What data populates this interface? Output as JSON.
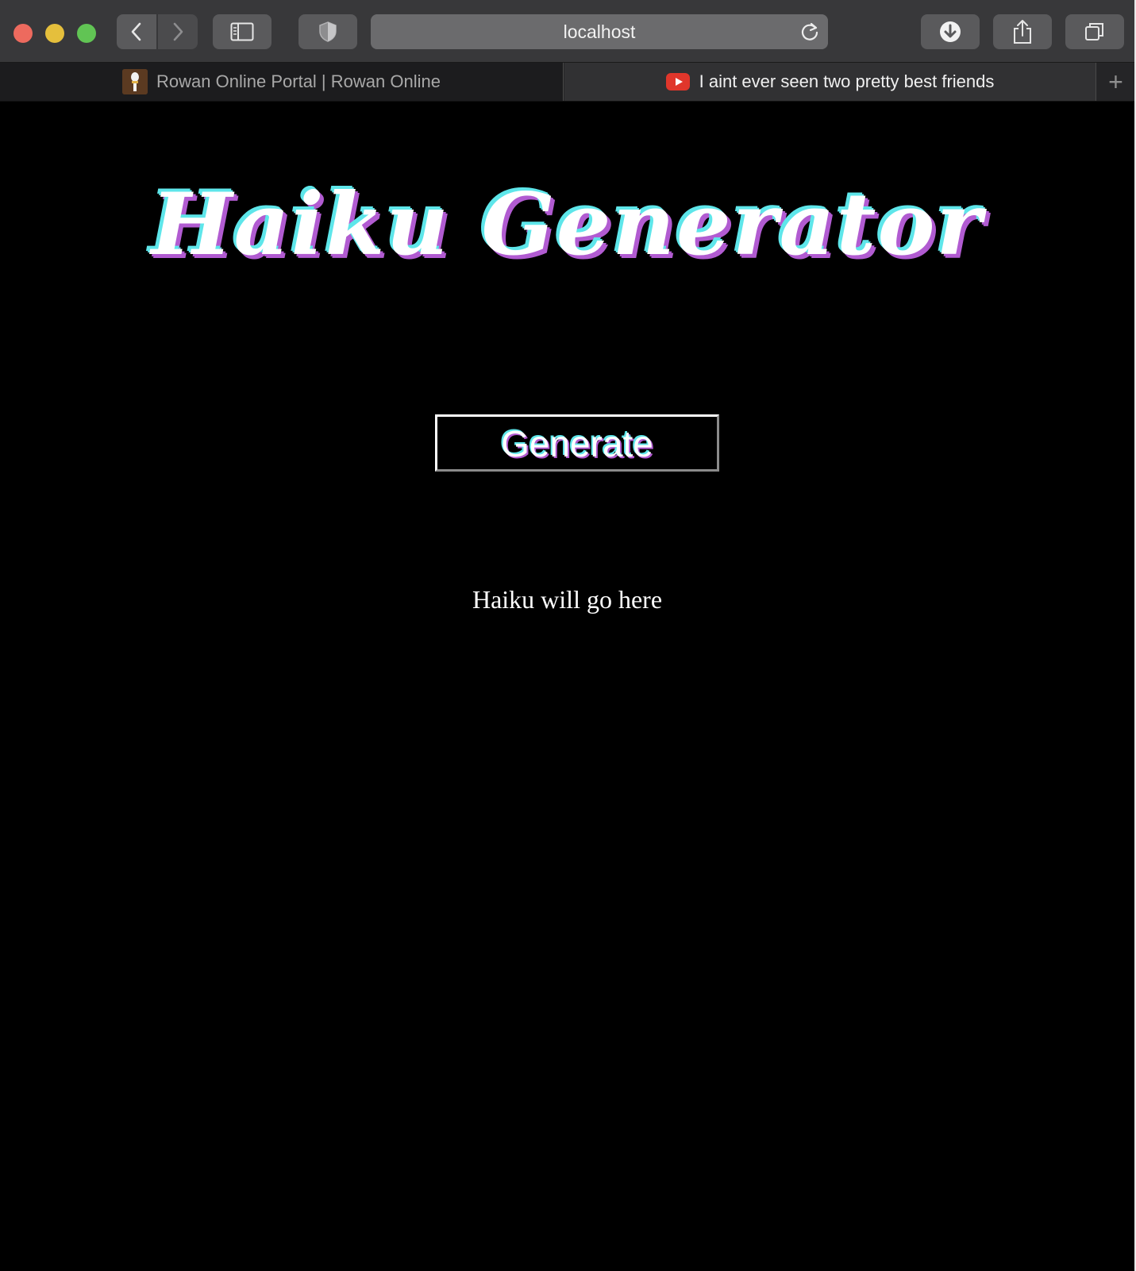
{
  "browser": {
    "address": "localhost",
    "tabs": [
      {
        "label": "Rowan Online Portal | Rowan Online",
        "favicon": "rowan-torch-icon",
        "active": false
      },
      {
        "label": "I aint ever seen two pretty best friends",
        "favicon": "youtube-icon",
        "active": true
      }
    ],
    "new_tab_symbol": "+"
  },
  "page": {
    "title": "Haiku Generator",
    "generate_label": "Generate",
    "haiku_placeholder": "Haiku will go here"
  },
  "colors": {
    "background": "#000000",
    "title_cyan": "#5ee6ea",
    "title_purple": "#b15bd1",
    "text": "#ffffff"
  }
}
